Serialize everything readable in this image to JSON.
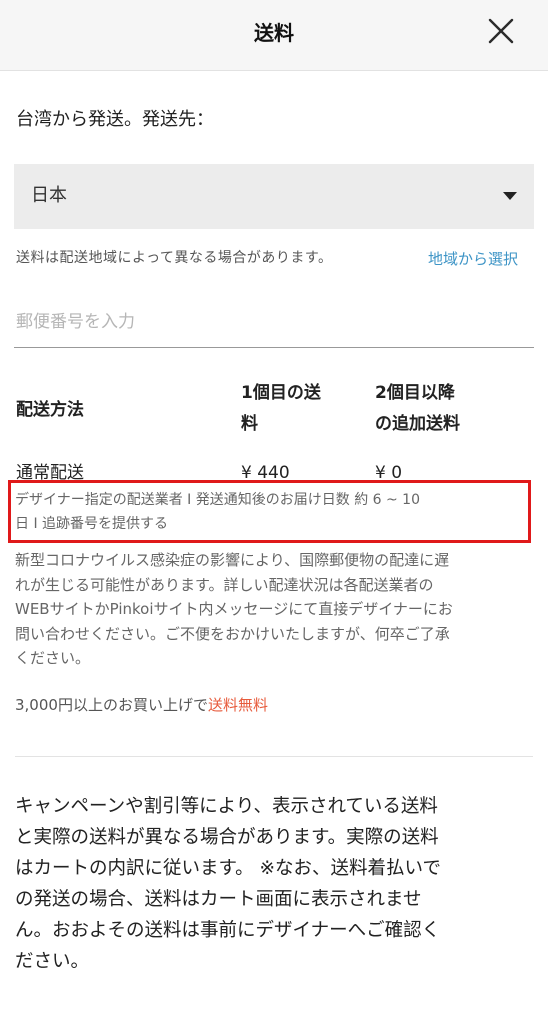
{
  "header": {
    "title": "送料",
    "close_icon": "close-icon"
  },
  "shipping": {
    "origin_text": "台湾から発送。発送先：",
    "destination": "日本",
    "region_note": "送料は配送地域によって異なる場合があります。",
    "region_link": "地域から選択",
    "postal_placeholder": "郵便番号を入力"
  },
  "table": {
    "headers": {
      "method": "配送方法",
      "first_item_line1": "1個目の送",
      "first_item_line2": "料",
      "additional_line1": "2個目以降",
      "additional_line2": "の追加送料"
    },
    "rows": [
      {
        "method": "通常配送",
        "first": "¥ 440",
        "additional": "¥ 0"
      }
    ]
  },
  "notes": {
    "carrier_line1": "デザイナー指定の配送業者 I 発送通知後のお届け日数 約 6 ~ 10",
    "carrier_line2": "日 I 追跡番号を提供する",
    "covid_lines": [
      "新型コロナウイルス感染症の影響により、国際郵便物の配達に遅",
      "れが生じる可能性があります。詳しい配達状況は各配送業者の",
      "WEBサイトかPinkoiサイト内メッセージにて直接デザイナーにお",
      "問い合わせください。ご不便をおかけいたしますが、何卒ご了承",
      "ください。"
    ],
    "free_prefix": "3,000円以上のお買い上げで",
    "free_accent": "送料無料"
  },
  "disclaimer_lines": [
    "キャンペーンや割引等により、表示されている送料",
    "と実際の送料が異なる場合があります。実際の送料",
    "はカートの内訳に従います。 ※なお、送料着払いで",
    "の発送の場合、送料はカート画面に表示されませ",
    "ん。おおよその送料は事前にデザイナーへご確認く",
    "ださい。"
  ],
  "colors": {
    "header_bg": "#f6f6f6",
    "select_bg": "#ececec",
    "link": "#3d94c6",
    "highlight_border": "#e0191a",
    "accent": "#e75b3c"
  }
}
